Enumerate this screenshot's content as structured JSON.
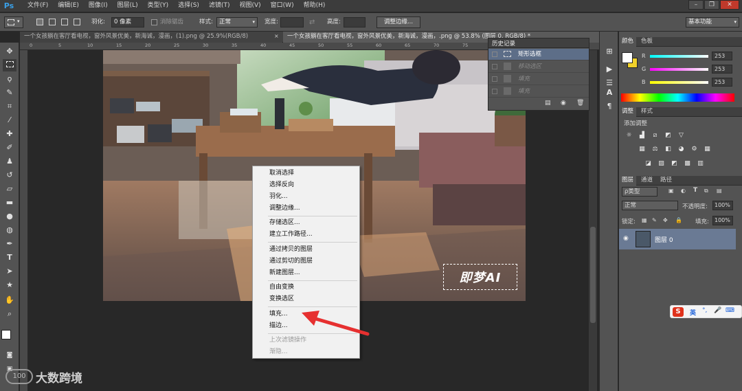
{
  "app": {
    "logo": "Ps"
  },
  "menubar": {
    "items": [
      "文件(F)",
      "编辑(E)",
      "图像(I)",
      "图层(L)",
      "类型(Y)",
      "选择(S)",
      "滤镜(T)",
      "视图(V)",
      "窗口(W)",
      "帮助(H)"
    ]
  },
  "window_controls": {
    "minimize": "–",
    "restore": "❐",
    "close": "✕"
  },
  "options_bar": {
    "feather_label": "羽化:",
    "feather_value": "0 像素",
    "antialias_label": "消除锯齿",
    "style_label": "样式:",
    "style_value": "正常",
    "width_label": "宽度:",
    "height_label": "高度:",
    "refine_button": "调整边缘...",
    "workspace_value": "基本功能"
  },
  "tabs": [
    {
      "label": "一个女孩躺在客厅看电视，窗外风景优美，新海诚，漫画，(1).png @ 25.9%(RGB/8)",
      "active": false
    },
    {
      "label": "一个女孩躺在客厅看电视，窗外风景优美，新海诚，漫画，.png @ 53.8% (图层 0, RGB/8) *",
      "active": true
    }
  ],
  "ruler": {
    "top_labels": [
      "0",
      "5",
      "10",
      "15",
      "20",
      "25",
      "30",
      "35",
      "40",
      "45",
      "50",
      "55",
      "60",
      "65",
      "70",
      "75",
      "80",
      "85",
      "90",
      "95"
    ]
  },
  "history_panel": {
    "title": "历史记录",
    "items": [
      {
        "label": "矩形选框",
        "active": true
      },
      {
        "label": "移动选区",
        "active": false
      },
      {
        "label": "填充",
        "active": false
      },
      {
        "label": "填充",
        "active": false
      }
    ]
  },
  "context_menu": {
    "groups": [
      [
        "取消选择",
        "选择反向",
        "羽化...",
        "调整边缘..."
      ],
      [
        "存储选区...",
        "建立工作路径..."
      ],
      [
        "通过拷贝的图层",
        "通过剪切的图层",
        "新建图层..."
      ],
      [
        "自由变换",
        "变换选区"
      ],
      [
        "填充...",
        "描边..."
      ]
    ],
    "disabled": [
      "上次滤镜操作",
      "渐隐..."
    ]
  },
  "canvas": {
    "watermark": "即梦AI"
  },
  "color_panel": {
    "tabs": [
      "颜色",
      "色板"
    ],
    "r_label": "R",
    "g_label": "G",
    "b_label": "B",
    "r": "253",
    "g": "253",
    "b": "253"
  },
  "adjust_panel": {
    "tabs": [
      "调整",
      "样式"
    ],
    "title": "添加调整"
  },
  "layers_panel": {
    "tabs": [
      "图层",
      "通道",
      "路径"
    ],
    "filter": "ρ类型",
    "blend_mode": "正常",
    "opacity_label": "不透明度:",
    "opacity": "100%",
    "lock_label": "锁定:",
    "fill_label": "填充:",
    "fill": "100%",
    "layer_name": "图层 0"
  },
  "ime_bar": {
    "lang": "英",
    "punct": "°,"
  },
  "watermark_logo": "大数跨境",
  "colors": {
    "foreground": "#ffffff",
    "background": "#f1d22a",
    "accent_arrow": "#e63030"
  }
}
